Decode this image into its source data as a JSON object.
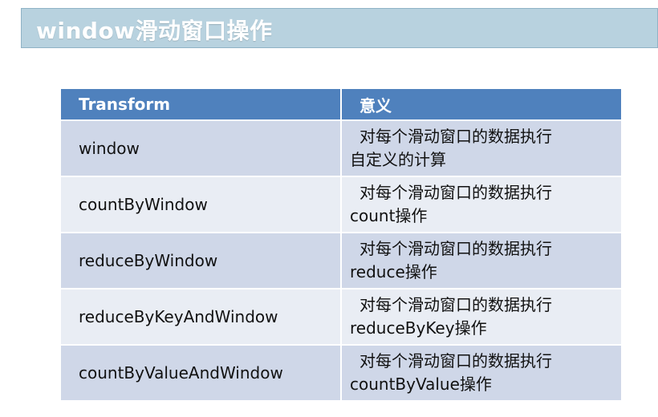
{
  "title": "window滑动窗口操作",
  "table": {
    "headers": [
      "Transform",
      "意义"
    ],
    "rows": [
      {
        "name": "window",
        "desc_line1": "对每个滑动窗口的数据执行",
        "desc_line2": "自定义的计算"
      },
      {
        "name": "countByWindow",
        "desc_line1": "对每个滑动窗口的数据执行",
        "desc_line2": "count操作"
      },
      {
        "name": "reduceByWindow",
        "desc_line1": "对每个滑动窗口的数据执行",
        "desc_line2": "reduce操作"
      },
      {
        "name": "reduceByKeyAndWindow",
        "desc_line1": "对每个滑动窗口的数据执行",
        "desc_line2": "reduceByKey操作"
      },
      {
        "name": "countByValueAndWindow",
        "desc_line1": "对每个滑动窗口的数据执行",
        "desc_line2": "countByValue操作"
      }
    ]
  },
  "colors": {
    "title_bar": "#b8d2df",
    "header_bg": "#4f81bd",
    "row_odd": "#cfd7e8",
    "row_even": "#e9edf4"
  }
}
